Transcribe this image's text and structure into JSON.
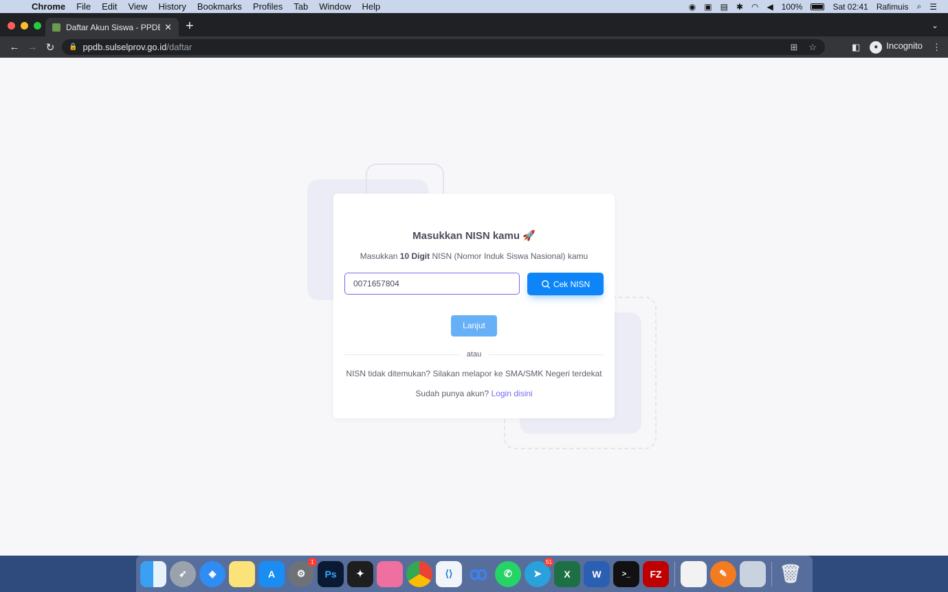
{
  "menubar": {
    "app_name": "Chrome",
    "items": [
      "File",
      "Edit",
      "View",
      "History",
      "Bookmarks",
      "Profiles",
      "Tab",
      "Window",
      "Help"
    ],
    "battery": "100%",
    "clock": "Sat 02:41",
    "user": "Rafimuis"
  },
  "browser": {
    "tab_title": "Daftar Akun Siswa - PPDB Sulsel",
    "url_host": "ppdb.sulselprov.go.id",
    "url_path": "/daftar",
    "profile": "Incognito"
  },
  "card": {
    "title": "Masukkan NISN kamu 🚀",
    "subtitle_prefix": "Masukkan ",
    "subtitle_bold": "10 Digit",
    "subtitle_suffix": " NISN (Nomor Induk Siswa Nasional) kamu",
    "nisn_value": "0071657804",
    "cek_button": "Cek NISN",
    "next_button": "Lanjut",
    "divider_text": "atau",
    "not_found_text": "NISN tidak ditemukan? Silakan melapor ke SMA/SMK Negeri terdekat",
    "login_prompt": "Sudah punya akun?",
    "login_link": "Login disini"
  },
  "dock": {
    "badges": {
      "system_preferences": "1",
      "telegram": "51"
    },
    "apps": [
      "finder",
      "launchpad",
      "safari",
      "notes",
      "app-store",
      "system-preferences",
      "photoshop",
      "figma",
      "keynote",
      "chrome",
      "vscode",
      "arc",
      "whatsapp",
      "telegram",
      "excel",
      "word",
      "terminal",
      "filezilla",
      "textedit",
      "sketchbook",
      "preview",
      "trash"
    ]
  }
}
